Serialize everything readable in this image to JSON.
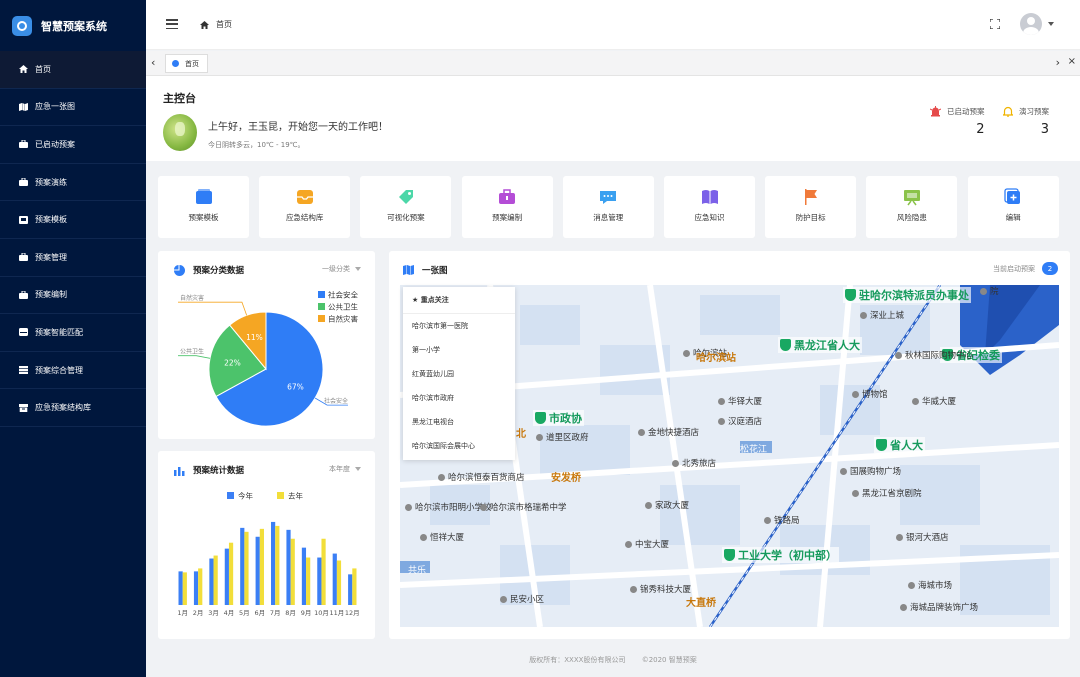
{
  "app": {
    "title": "智慧预案系统"
  },
  "nav": [
    {
      "label": "首页",
      "icon": "home-icon"
    },
    {
      "label": "应急一张图",
      "icon": "map-icon"
    },
    {
      "label": "已启动预案",
      "icon": "briefcase-icon"
    },
    {
      "label": "预案演练",
      "icon": "briefcase-icon"
    },
    {
      "label": "预案模板",
      "icon": "template-icon"
    },
    {
      "label": "预案管理",
      "icon": "briefcase-icon"
    },
    {
      "label": "预案编制",
      "icon": "briefcase-icon"
    },
    {
      "label": "预案智能匹配",
      "icon": "drawer-icon"
    },
    {
      "label": "预案综合管理",
      "icon": "stack-icon"
    },
    {
      "label": "应急预案结构库",
      "icon": "archive-icon"
    }
  ],
  "header": {
    "breadcrumb": "首页"
  },
  "tabs": {
    "home": "首页"
  },
  "welcome": {
    "title": "主控台",
    "greeting": "上午好，王玉昆，开始您一天的工作吧！",
    "weather": "今日阴转多云，10℃ - 19℃。",
    "stats": [
      {
        "label": "已启动预案",
        "value": "2",
        "color": "#e54a4a"
      },
      {
        "label": "演习预案",
        "value": "3",
        "color": "#f0b400"
      }
    ]
  },
  "quick_links": [
    {
      "label": "预案模板",
      "icon": "folder-icon",
      "color": "#2f7df6"
    },
    {
      "label": "应急结构库",
      "icon": "inbox-icon",
      "color": "#f5a623"
    },
    {
      "label": "可视化预案",
      "icon": "tag-icon",
      "color": "#4cd7a8"
    },
    {
      "label": "预案编制",
      "icon": "toolbox-icon",
      "color": "#b44dd6"
    },
    {
      "label": "消息管理",
      "icon": "chat-icon",
      "color": "#3aa0f0"
    },
    {
      "label": "应急知识",
      "icon": "book-icon",
      "color": "#7b61e8"
    },
    {
      "label": "防护目标",
      "icon": "flag-icon",
      "color": "#f07a3a"
    },
    {
      "label": "风险隐患",
      "icon": "board-icon",
      "color": "#8bc34a"
    },
    {
      "label": "编辑",
      "icon": "edit-icon",
      "color": "#2f7df6"
    }
  ],
  "category_card": {
    "title": "预案分类数据",
    "filter": "一级分类"
  },
  "stats_card": {
    "title": "预案统计数据",
    "filter": "本年度"
  },
  "chart_data": [
    {
      "type": "pie",
      "title": "预案分类数据",
      "slices": [
        {
          "name": "社会安全",
          "value": 67,
          "color": "#2f7df6"
        },
        {
          "name": "公共卫生",
          "value": 22,
          "color": "#4cc36b"
        },
        {
          "name": "自然灾害",
          "value": 11,
          "color": "#f5a623"
        }
      ],
      "legend": "top-right"
    },
    {
      "type": "bar",
      "title": "预案统计数据",
      "categories": [
        "1月",
        "2月",
        "3月",
        "4月",
        "5月",
        "6月",
        "7月",
        "8月",
        "9月",
        "10月",
        "11月",
        "12月"
      ],
      "series": [
        {
          "name": "今年",
          "color": "#3b7ff5",
          "values": [
            34,
            34,
            47,
            57,
            78,
            69,
            84,
            76,
            58,
            48,
            52,
            31
          ]
        },
        {
          "name": "去年",
          "color": "#f2de3a",
          "values": [
            33,
            37,
            50,
            63,
            74,
            77,
            80,
            67,
            48,
            67,
            45,
            37
          ]
        }
      ],
      "ylim": [
        0,
        90
      ],
      "legend": "top-center"
    }
  ],
  "map_card": {
    "title": "一张图",
    "right_label": "当前启动预案",
    "badge": "2"
  },
  "focus_list": {
    "header": "★ 重点关注",
    "items": [
      "哈尔滨市第一医院",
      "第一小学",
      "红黄蓝幼儿园",
      "哈尔滨市政府",
      "黑龙江电视台",
      "哈尔滨国际会展中心"
    ]
  },
  "map_labels": [
    {
      "text": "驻哈尔滨特派员办事处",
      "kind": "green"
    },
    {
      "text": "黑龙江省人大",
      "kind": "green"
    },
    {
      "text": "省纪检委",
      "kind": "green"
    },
    {
      "text": "市政协",
      "kind": "green"
    },
    {
      "text": "省人大",
      "kind": "green"
    },
    {
      "text": "工业大学（初中部）",
      "kind": "green"
    },
    {
      "text": "博物馆",
      "kind": "dark"
    },
    {
      "text": "铁路局",
      "kind": "dark"
    },
    {
      "text": "哈尔滨站",
      "kind": "dark"
    },
    {
      "text": "哈尔滨站",
      "kind": "orange"
    },
    {
      "text": "安发桥",
      "kind": "orange"
    },
    {
      "text": "大直桥",
      "kind": "orange"
    },
    {
      "text": "华铎大厦",
      "kind": "dark"
    },
    {
      "text": "汉庭酒店",
      "kind": "dark"
    },
    {
      "text": "金地快捷酒店",
      "kind": "dark"
    },
    {
      "text": "北秀旅店",
      "kind": "dark"
    },
    {
      "text": "家政大厦",
      "kind": "dark"
    },
    {
      "text": "中宝大厦",
      "kind": "dark"
    },
    {
      "text": "锦秀科技大厦",
      "kind": "dark"
    },
    {
      "text": "民安小区",
      "kind": "dark"
    },
    {
      "text": "道里区政府",
      "kind": "dark"
    },
    {
      "text": "哈尔滨市阳明小学校",
      "kind": "dark"
    },
    {
      "text": "恒祥大厦",
      "kind": "dark"
    },
    {
      "text": "哈尔滨市格瑞希中学",
      "kind": "dark"
    },
    {
      "text": "哈尔滨恒泰百货商店",
      "kind": "dark"
    },
    {
      "text": "秋林国际购物中心",
      "kind": "dark"
    },
    {
      "text": "华威大厦",
      "kind": "dark"
    },
    {
      "text": "国展购物广场",
      "kind": "dark"
    },
    {
      "text": "黑龙江省京剧院",
      "kind": "dark"
    },
    {
      "text": "银河大酒店",
      "kind": "dark"
    },
    {
      "text": "海城市场",
      "kind": "dark"
    },
    {
      "text": "海城品牌装饰广场",
      "kind": "dark"
    },
    {
      "text": "深业上城",
      "kind": "dark"
    },
    {
      "text": "院",
      "kind": "dark"
    },
    {
      "text": "松花江",
      "kind": "water"
    },
    {
      "text": "共乐",
      "kind": "water"
    },
    {
      "text": "北",
      "kind": "orange"
    }
  ],
  "footer": {
    "left": "版权所有：XXXX股份有限公司",
    "right": "©2020 智慧预案"
  }
}
